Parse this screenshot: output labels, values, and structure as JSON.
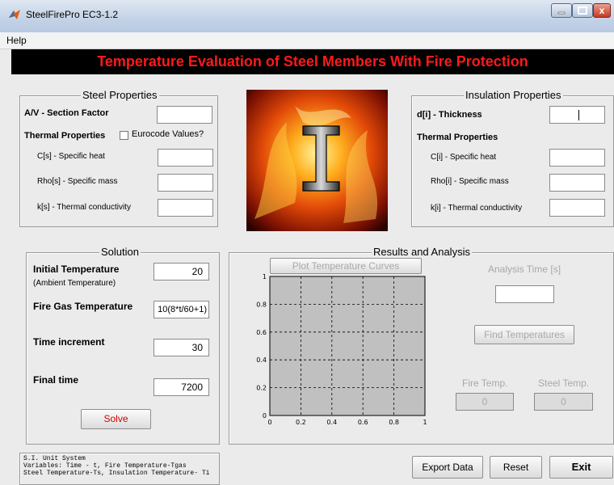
{
  "window": {
    "title": "SteelFirePro EC3-1.2",
    "close_glyph": "x"
  },
  "menu": {
    "items": [
      "Help"
    ]
  },
  "header": {
    "title": "Temperature Evaluation of Steel Members With Fire Protection"
  },
  "steel": {
    "title": "Steel Properties",
    "section_factor_label": "A/V - Section Factor",
    "thermal_label": "Thermal Properties",
    "eurocode_label": "Eurocode Values?",
    "eurocode_checked": false,
    "specific_heat_label": "C[s] - Specific heat",
    "specific_mass_label": "Rho[s] - Specific mass",
    "conductivity_label": "k[s] - Thermal conductivity",
    "section_factor_value": "",
    "specific_heat_value": "",
    "specific_mass_value": "",
    "conductivity_value": ""
  },
  "insulation": {
    "title": "Insulation Properties",
    "thickness_label": "d[i] - Thickness",
    "thermal_label": "Thermal Properties",
    "specific_heat_label": "C[i] - Specific heat",
    "specific_mass_label": "Rho[i] - Specific mass",
    "conductivity_label": "k[i] - Thermal conductivity",
    "thickness_value": "",
    "specific_heat_value": "",
    "specific_mass_value": "",
    "conductivity_value": ""
  },
  "solution": {
    "title": "Solution",
    "initial_temp_label": "Initial Temperature",
    "initial_temp_sub": "(Ambient Temperature)",
    "initial_temp_value": "20",
    "fire_gas_label": "Fire Gas Temperature",
    "fire_gas_value": "10(8*t/60+1)",
    "time_inc_label": "Time increment",
    "time_inc_value": "30",
    "final_time_label": "Final time",
    "final_time_value": "7200",
    "solve_label": "Solve"
  },
  "results": {
    "title": "Results and Analysis",
    "plot_button": "Plot Temperature Curves",
    "analysis_time_label": "Analysis Time [s]",
    "analysis_time_value": "",
    "find_button": "Find Temperatures",
    "fire_temp_label": "Fire Temp.",
    "steel_temp_label": "Steel Temp.",
    "fire_temp_value": "0",
    "steel_temp_value": "0"
  },
  "axes": {
    "x_ticks": [
      "0",
      "0.2",
      "0.4",
      "0.6",
      "0.8",
      "1"
    ],
    "y_ticks": [
      "0",
      "0.2",
      "0.4",
      "0.6",
      "0.8",
      "1"
    ],
    "background": "#c0c0c0",
    "xlim": [
      0,
      1
    ],
    "ylim": [
      0,
      1
    ]
  },
  "info": {
    "lines": [
      "S.I. Unit System",
      "Variables: Time - t, Fire Temperature-Tgas",
      "Steel Temperature-Ts, Insulation Temperature- Ti"
    ]
  },
  "footer": {
    "export_label": "Export Data",
    "reset_label": "Reset",
    "exit_label": "Exit"
  },
  "colors": {
    "header_bg": "#000000",
    "header_text": "#ff1a1a",
    "solve_text": "#d40000",
    "window_bg": "#ebebeb"
  }
}
